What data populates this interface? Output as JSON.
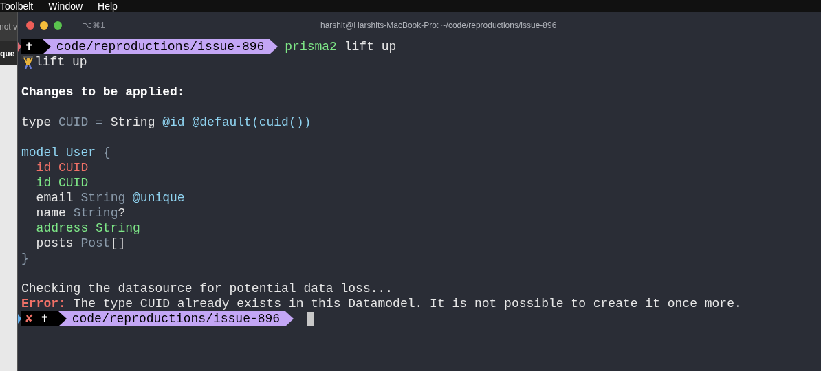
{
  "menu_bar": {
    "items": [
      "Toolbelt",
      "Window",
      "Help"
    ]
  },
  "background_window": {
    "texts": [
      "not v",
      "que"
    ]
  },
  "window": {
    "tab_shortcut": "⌥⌘1",
    "title": "harshit@Harshits-MacBook-Pro: ~/code/reproductions/issue-896"
  },
  "terminal": {
    "lines": [
      {
        "kind": "prompt",
        "last_failed": false,
        "cursor": false,
        "marks": [
          {
            "text": "✝",
            "kind": "plain"
          }
        ],
        "path": "code/reproductions/issue-896",
        "segments": [
          {
            "text": "prisma2",
            "kind": "added"
          },
          {
            "text": " lift up",
            "kind": "plain"
          }
        ]
      },
      {
        "kind": "lifter_text",
        "segments": [
          {
            "text": "lift up",
            "kind": "plain"
          }
        ]
      },
      {
        "kind": "blank"
      },
      {
        "kind": "text",
        "segments": [
          {
            "text": "Changes to be applied:",
            "kind": "bold"
          }
        ]
      },
      {
        "kind": "blank"
      },
      {
        "kind": "text",
        "segments": [
          {
            "text": "type ",
            "kind": "plain"
          },
          {
            "text": "CUID = ",
            "kind": "muted"
          },
          {
            "text": "String ",
            "kind": "plain"
          },
          {
            "text": "@id @default(cuid())",
            "kind": "keyword"
          }
        ]
      },
      {
        "kind": "blank"
      },
      {
        "kind": "text",
        "segments": [
          {
            "text": "model User ",
            "kind": "keyword"
          },
          {
            "text": "{",
            "kind": "muted"
          }
        ]
      },
      {
        "kind": "text",
        "segments": [
          {
            "text": "  id CUID",
            "kind": "removed"
          }
        ]
      },
      {
        "kind": "text",
        "segments": [
          {
            "text": "  id CUID",
            "kind": "added"
          }
        ]
      },
      {
        "kind": "text",
        "segments": [
          {
            "text": "  email ",
            "kind": "plain"
          },
          {
            "text": "String ",
            "kind": "muted"
          },
          {
            "text": "@unique",
            "kind": "keyword"
          }
        ]
      },
      {
        "kind": "text",
        "segments": [
          {
            "text": "  name ",
            "kind": "plain"
          },
          {
            "text": "String",
            "kind": "muted"
          },
          {
            "text": "?",
            "kind": "plain"
          }
        ]
      },
      {
        "kind": "text",
        "segments": [
          {
            "text": "  address String",
            "kind": "added"
          }
        ]
      },
      {
        "kind": "text",
        "segments": [
          {
            "text": "  posts ",
            "kind": "plain"
          },
          {
            "text": "Post",
            "kind": "muted"
          },
          {
            "text": "[]",
            "kind": "plain"
          }
        ]
      },
      {
        "kind": "text",
        "segments": [
          {
            "text": "}",
            "kind": "muted"
          }
        ]
      },
      {
        "kind": "blank"
      },
      {
        "kind": "text",
        "segments": [
          {
            "text": "Checking the datasource for potential data loss...",
            "kind": "plain"
          }
        ]
      },
      {
        "kind": "text",
        "segments": [
          {
            "text": "Error:",
            "kind": "error"
          },
          {
            "text": " The type CUID already exists in this Datamodel. It is not possible to create it once more.",
            "kind": "plain"
          }
        ]
      },
      {
        "kind": "prompt",
        "last_failed": true,
        "cursor": true,
        "marks": [
          {
            "text": "✘",
            "kind": "error"
          },
          {
            "text": "✝",
            "kind": "plain"
          }
        ],
        "path": "code/reproductions/issue-896"
      }
    ]
  }
}
